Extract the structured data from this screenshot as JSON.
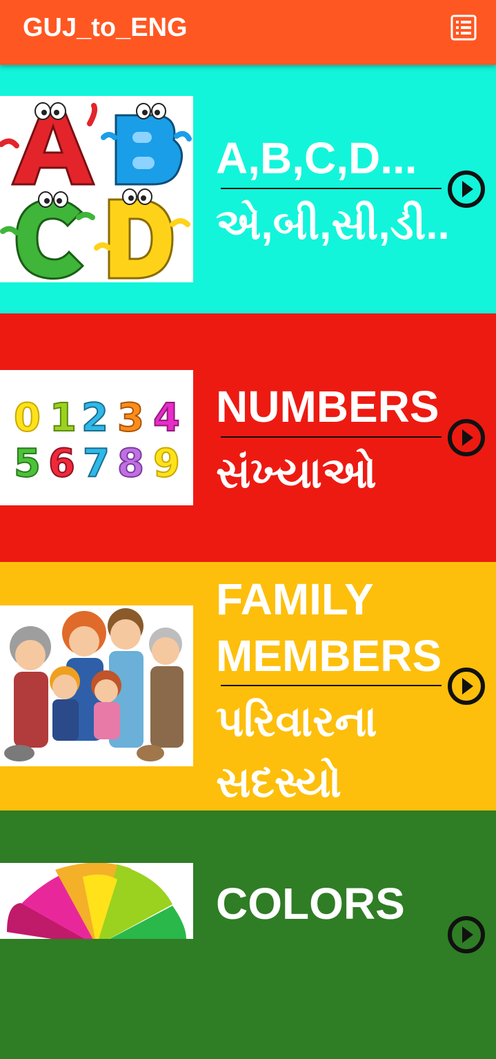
{
  "app": {
    "title": "GUJ_to_ENG",
    "menu_icon": "list-icon",
    "appbar_color": "#ff5722"
  },
  "cards": [
    {
      "english": "A,B,C,D...",
      "gujarati": "એ,બી,સી,ડી..",
      "color": "#12f5db",
      "image": "alphabet-letters-abcd",
      "icon": "play-circle-icon"
    },
    {
      "english": "NUMBERS",
      "gujarati": "સંખ્યાઓ",
      "color": "#ed1a12",
      "image": "colorful-digits-0-9",
      "icon": "play-circle-icon"
    },
    {
      "english_line1": "FAMILY",
      "english_line2": "MEMBERS",
      "gujarati_line1": "પરિવારના",
      "gujarati_line2": "સદસ્યો",
      "color": "#fdbf0b",
      "image": "family-group-cartoon",
      "icon": "play-circle-icon"
    },
    {
      "english": "COLORS",
      "color": "#2f7d25",
      "image": "rainbow-flower",
      "icon": "play-circle-icon"
    }
  ]
}
